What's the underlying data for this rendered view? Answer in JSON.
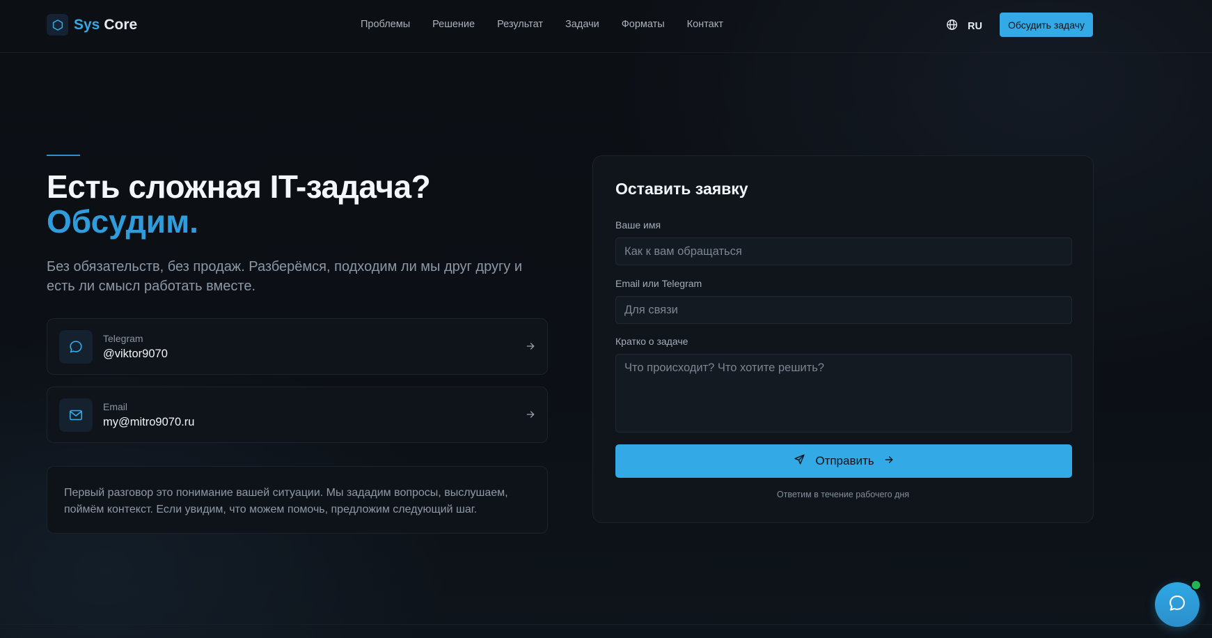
{
  "brand": {
    "part1": "Sys",
    "part2": "Core",
    "icon": "hexagon-icon"
  },
  "nav": {
    "items": [
      {
        "label": "Проблемы"
      },
      {
        "label": "Решение"
      },
      {
        "label": "Результат"
      },
      {
        "label": "Задачи"
      },
      {
        "label": "Форматы"
      },
      {
        "label": "Контакт"
      }
    ]
  },
  "header": {
    "language": "RU",
    "language_icon": "globe-icon",
    "cta_label": "Обсудить задачу"
  },
  "hero": {
    "title": "Есть сложная IT-задача?",
    "title_accent": "Обсудим.",
    "subtitle": "Без обязательств, без продаж. Разберёмся, подходим ли мы друг другу и есть ли смысл работать вместе."
  },
  "contacts": [
    {
      "label": "Telegram",
      "value": "@viktor9070",
      "icon": "chat-bubble-icon"
    },
    {
      "label": "Email",
      "value": "my@mitro9070.ru",
      "icon": "mail-icon"
    }
  ],
  "note": "Первый разговор это понимание вашей ситуации. Мы зададим вопросы, выслушаем, поймём контекст. Если увидим, что можем помочь, предложим следующий шаг.",
  "form": {
    "title": "Оставить заявку",
    "name_label": "Ваше имя",
    "name_placeholder": "Как к вам обращаться",
    "contact_label": "Email или Telegram",
    "contact_placeholder": "Для связи",
    "task_label": "Кратко о задаче",
    "task_placeholder": "Что происходит? Что хотите решить?",
    "submit_label": "Отправить",
    "footer": "Ответим в течение рабочего дня"
  },
  "colors": {
    "accent": "#33a9e6",
    "background": "#0b0e13",
    "online": "#22b455"
  }
}
